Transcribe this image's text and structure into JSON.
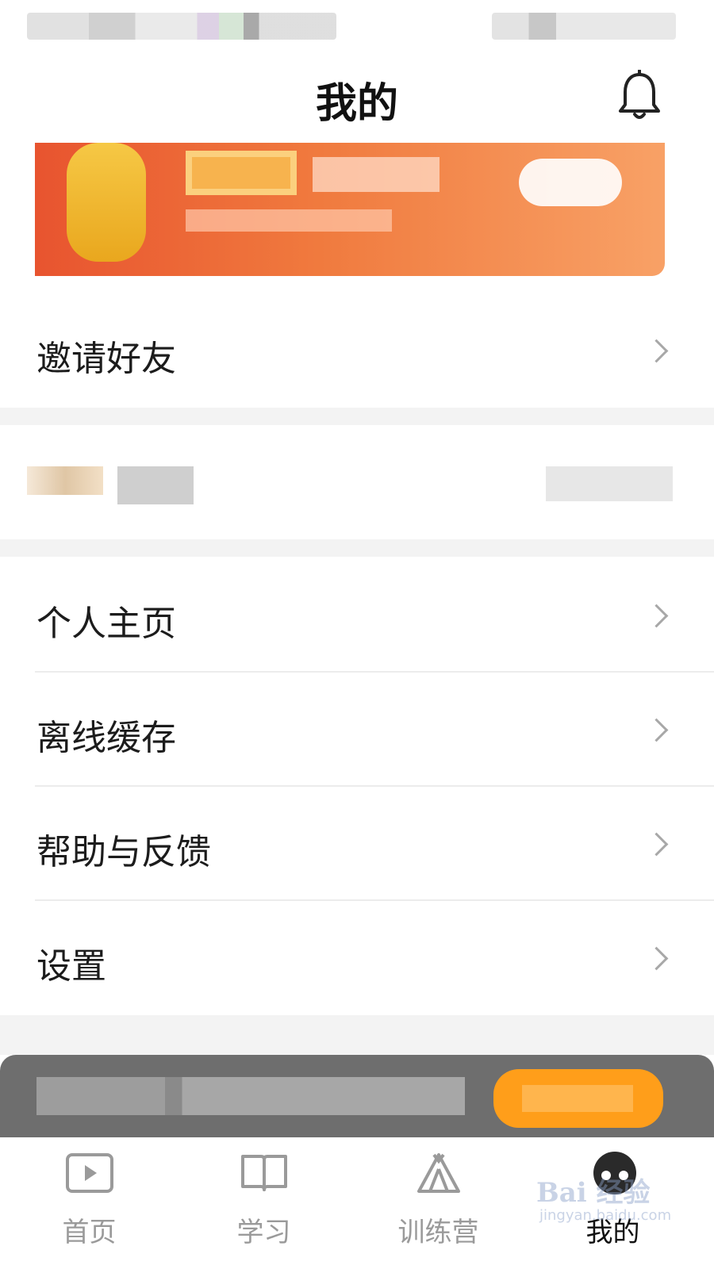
{
  "header": {
    "title": "我的",
    "icon": "bell-icon"
  },
  "menu": {
    "invite": "邀请好友",
    "profile": "个人主页",
    "offline": "离线缓存",
    "help": "帮助与反馈",
    "settings": "设置"
  },
  "tabs": [
    {
      "label": "首页",
      "icon": "video-play-icon",
      "active": false
    },
    {
      "label": "学习",
      "icon": "book-icon",
      "active": false
    },
    {
      "label": "训练营",
      "icon": "tent-icon",
      "active": false
    },
    {
      "label": "我的",
      "icon": "avatar-icon",
      "active": true
    }
  ],
  "watermark": {
    "main": "Bai 经验",
    "sub": "jingyan.baidu.com"
  },
  "colors": {
    "banner_start": "#e8542f",
    "banner_end": "#f8a166",
    "player_button": "#ff9e1a",
    "player_bar": "#6e6e6e"
  }
}
